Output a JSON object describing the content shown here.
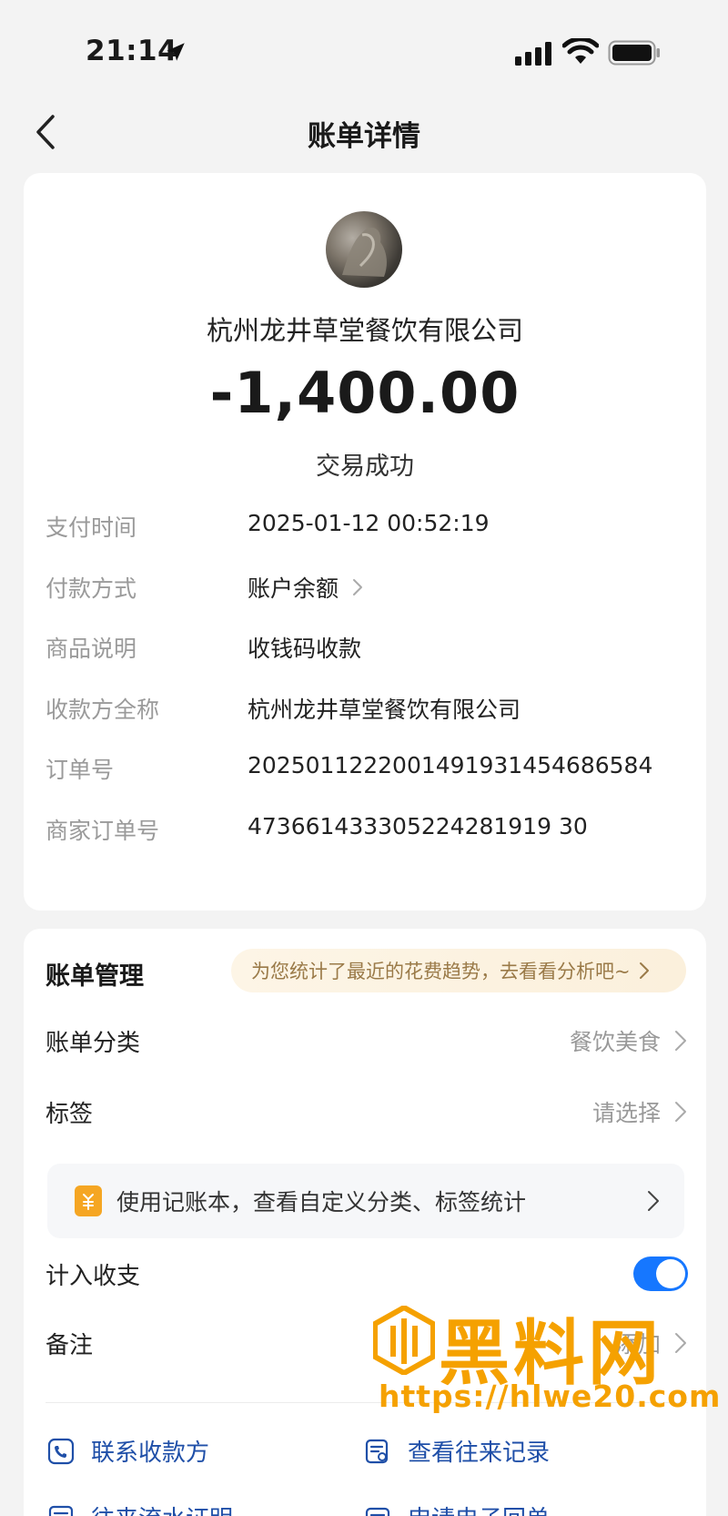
{
  "status_bar": {
    "time": "21:14",
    "icons": [
      "location-arrow-icon",
      "signal-icon",
      "wifi-icon",
      "battery-icon"
    ]
  },
  "nav": {
    "back_icon": "chevron-left-icon",
    "title": "账单详情"
  },
  "summary": {
    "avatar": "merchant-avatar",
    "merchant_name": "杭州龙井草堂餐饮有限公司",
    "amount": "-1,400.00",
    "status": "交易成功"
  },
  "details": [
    {
      "label": "支付时间",
      "value": "2025-01-12 00:52:19"
    },
    {
      "label": "付款方式",
      "value": "账户余额",
      "has_chevron": true
    },
    {
      "label": "商品说明",
      "value": "收钱码收款"
    },
    {
      "label": "收款方全称",
      "value": "杭州龙井草堂餐饮有限公司"
    },
    {
      "label": "订单号",
      "value": "2025011222001491931454686584"
    },
    {
      "label": "商家订单号",
      "value": "473661433305224281919 30"
    }
  ],
  "management": {
    "title": "账单管理",
    "hint": "为您统计了最近的花费趋势，去看看分析吧~",
    "category_label": "账单分类",
    "category_value": "餐饮美食",
    "tag_label": "标签",
    "tag_value": "请选择",
    "ledger_text": "使用记账本，查看自定义分类、标签统计",
    "include_label": "计入收支",
    "include_enabled": true,
    "note_label": "备注",
    "note_value": "添加"
  },
  "actions": {
    "contact_payee": "联系收款方",
    "view_records": "查看往来记录",
    "flow_proof": "往来流水证明",
    "e_receipt": "申请电子回单"
  },
  "watermark": {
    "brand": "黑料网",
    "url": "https://hlwe20.com"
  },
  "colors": {
    "accent_blue": "#1677ff",
    "link_blue": "#1f4fa8",
    "hint_text": "#9a7a48",
    "watermark_orange": "#f5a100"
  }
}
